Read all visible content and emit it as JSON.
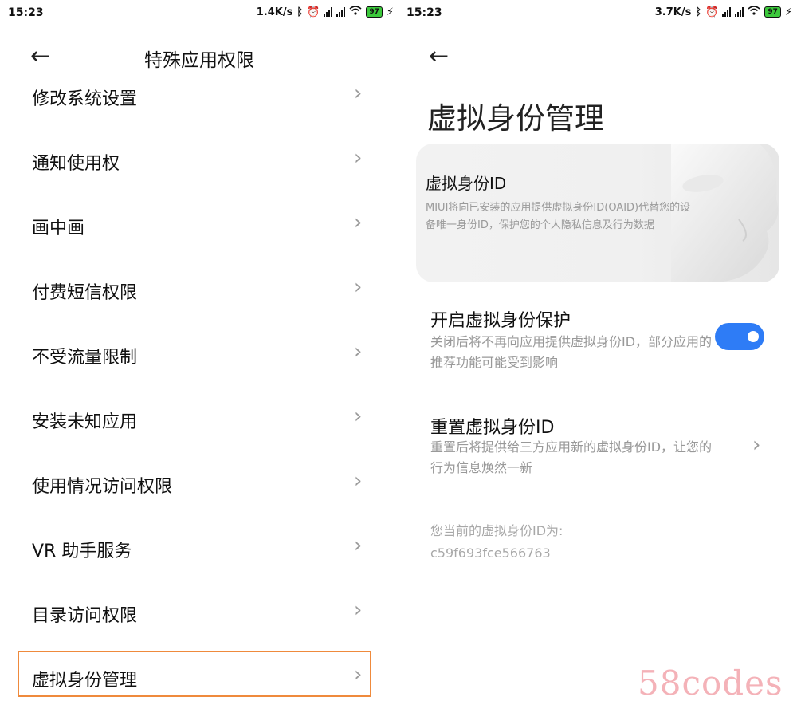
{
  "left": {
    "status": {
      "time": "15:23",
      "speed": "1.4K/s",
      "battery": "97"
    },
    "title": "特殊应用权限",
    "items": [
      {
        "label": "修改系统设置"
      },
      {
        "label": "通知使用权"
      },
      {
        "label": "画中画"
      },
      {
        "label": "付费短信权限"
      },
      {
        "label": "不受流量限制"
      },
      {
        "label": "安装未知应用"
      },
      {
        "label": "使用情况访问权限"
      },
      {
        "label": "VR 助手服务"
      },
      {
        "label": "目录访问权限"
      },
      {
        "label": "虚拟身份管理"
      }
    ]
  },
  "right": {
    "status": {
      "time": "15:23",
      "speed": "3.7K/s",
      "battery": "97"
    },
    "title": "虚拟身份管理",
    "card": {
      "title": "虚拟身份ID",
      "desc": "MIUI将向已安装的应用提供虚拟身份ID(OAID)代替您的设备唯一身份ID，保护您的个人隐私信息及行为数据"
    },
    "protection": {
      "title": "开启虚拟身份保护",
      "desc": "关闭后将不再向应用提供虚拟身份ID，部分应用的推荐功能可能受到影响",
      "enabled": true
    },
    "reset": {
      "title": "重置虚拟身份ID",
      "desc": "重置后将提供给三方应用新的虚拟身份ID，让您的行为信息焕然一新"
    },
    "current": {
      "label": "您当前的虚拟身份ID为:",
      "value": "c59f693fce566763"
    }
  },
  "icons": {
    "back": "arrow-left-icon",
    "chevron": "chevron-right-icon",
    "bluetooth": "bluetooth-icon",
    "alarm": "alarm-icon",
    "wifi": "wifi-icon",
    "charging": "charging-icon",
    "signal": "signal-icon"
  },
  "colors": {
    "toggle_on": "#2e7cf6",
    "highlight": "#ef8a3c",
    "watermark": "#f4b2b8"
  },
  "watermark": "58codes"
}
